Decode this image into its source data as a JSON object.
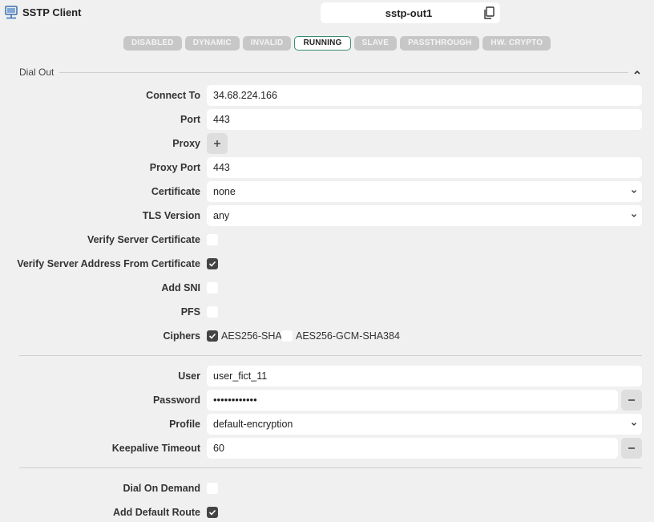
{
  "header": {
    "app_title": "SSTP Client",
    "name": "sstp-out1",
    "app_icon": "network-monitor-icon",
    "copy_icon": "copy-icon"
  },
  "flags": [
    {
      "label": "DISABLED",
      "active": false
    },
    {
      "label": "DYNAMIC",
      "active": false
    },
    {
      "label": "INVALID",
      "active": false
    },
    {
      "label": "RUNNING",
      "active": true
    },
    {
      "label": "SLAVE",
      "active": false
    },
    {
      "label": "PASSTHROUGH",
      "active": false
    },
    {
      "label": "HW. CRYPTO",
      "active": false
    }
  ],
  "section": {
    "title": "Dial Out",
    "collapse_icon": "chevron-up-icon"
  },
  "form": {
    "connect_to": {
      "label": "Connect To",
      "value": "34.68.224.166"
    },
    "port": {
      "label": "Port",
      "value": "443"
    },
    "proxy": {
      "label": "Proxy",
      "button": "+"
    },
    "proxy_port": {
      "label": "Proxy Port",
      "value": "443"
    },
    "certificate": {
      "label": "Certificate",
      "value": "none"
    },
    "tls_version": {
      "label": "TLS Version",
      "value": "any"
    },
    "verify_server_certificate": {
      "label": "Verify Server Certificate",
      "checked": false
    },
    "verify_server_address": {
      "label": "Verify Server Address From Certificate",
      "checked": true
    },
    "add_sni": {
      "label": "Add SNI",
      "checked": false
    },
    "pfs": {
      "label": "PFS",
      "checked": false
    },
    "ciphers": {
      "label": "Ciphers",
      "options": [
        {
          "label": "AES256-SHA",
          "checked": true
        },
        {
          "label": "AES256-GCM-SHA384",
          "checked": false
        }
      ]
    },
    "user": {
      "label": "User",
      "value": "user_fict_11"
    },
    "password": {
      "label": "Password",
      "value": "••••••••••••"
    },
    "profile": {
      "label": "Profile",
      "value": "default-encryption"
    },
    "keepalive_timeout": {
      "label": "Keepalive Timeout",
      "value": "60"
    },
    "dial_on_demand": {
      "label": "Dial On Demand",
      "checked": false
    },
    "add_default_route": {
      "label": "Add Default Route",
      "checked": true
    }
  },
  "colors": {
    "background": "#f0f0f0",
    "field": "#ffffff",
    "flag_inactive": "#c7c7c7",
    "flag_active_border": "#3a8a72",
    "checkbox_checked": "#444444"
  }
}
